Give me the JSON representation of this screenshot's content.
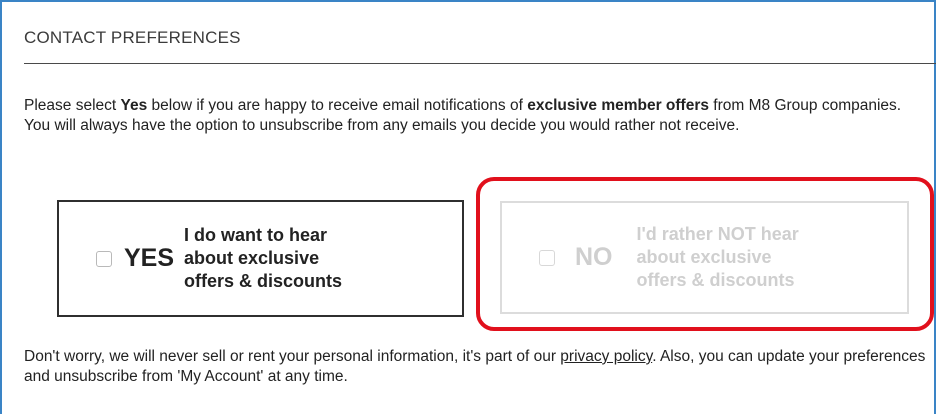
{
  "section": {
    "title": "CONTACT PREFERENCES"
  },
  "intro": {
    "part1": "Please select ",
    "yes_bold": "Yes",
    "part2": " below if you are happy to receive email notifications of ",
    "offers_bold": "exclusive member offers",
    "part3": " from M8 Group companies. You will always have the option to unsubscribe from any emails you decide you would rather not receive."
  },
  "options": {
    "yes": {
      "word": "YES",
      "description": "I do want to hear\nabout exclusive\noffers & discounts",
      "checked": false
    },
    "no": {
      "word": "NO",
      "description": "I'd rather NOT hear\nabout exclusive\noffers & discounts",
      "checked": false
    }
  },
  "footer": {
    "part1": "Don't worry, we will never sell or rent your personal information, it's part of our ",
    "link": "privacy policy",
    "part2": ". Also, you can update your preferences and unsubscribe from 'My Account' at any time."
  },
  "colors": {
    "frame_border": "#3a84c6",
    "highlight": "#e1101c",
    "disabled_text": "#cfcfcf"
  }
}
